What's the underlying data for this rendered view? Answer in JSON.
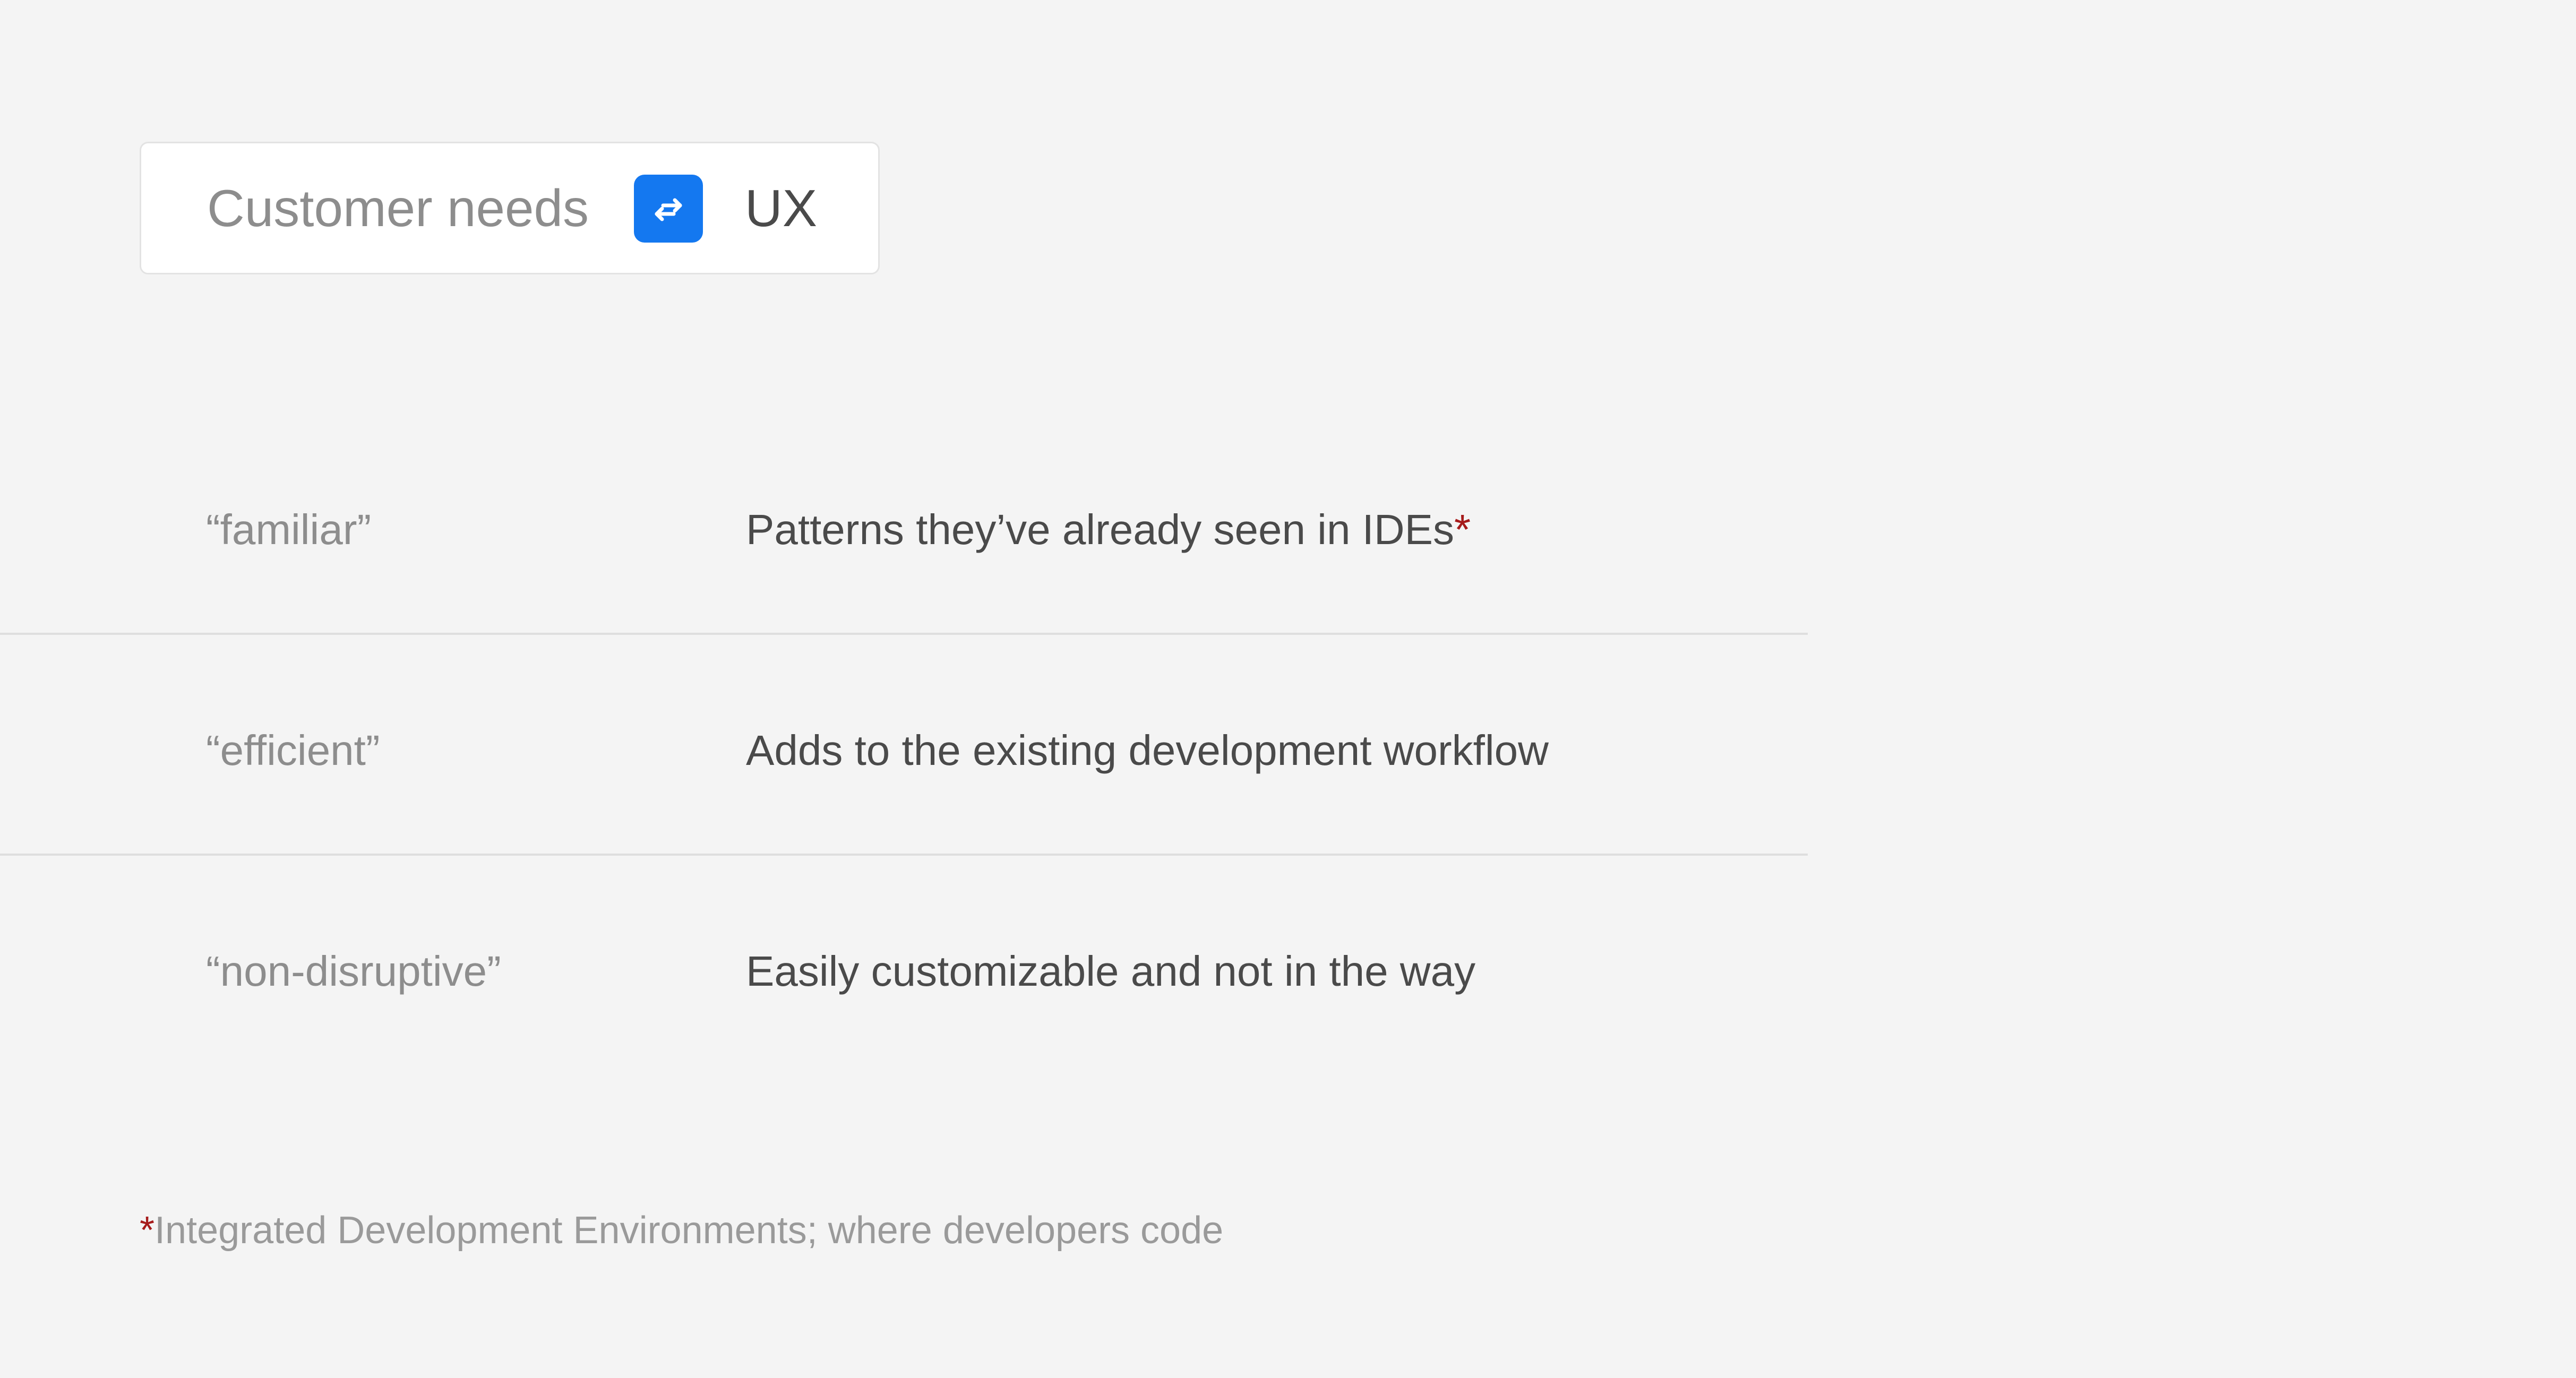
{
  "toggle": {
    "left_label": "Customer needs",
    "right_label": "UX",
    "swap_icon": "swap-arrows-icon",
    "accent_color": "#1478f0"
  },
  "rows": [
    {
      "term": "“familiar”",
      "description": "Patterns they’ve already seen in IDEs",
      "marker": "*"
    },
    {
      "term": "“efficient”",
      "description": "Adds to the existing development workflow"
    },
    {
      "term": "“non-disruptive”",
      "description": "Easily customizable and not in the way"
    }
  ],
  "footnote": {
    "marker": "*",
    "text": "Integrated Development Environments; where developers code",
    "marker_color": "#a61b1b"
  }
}
